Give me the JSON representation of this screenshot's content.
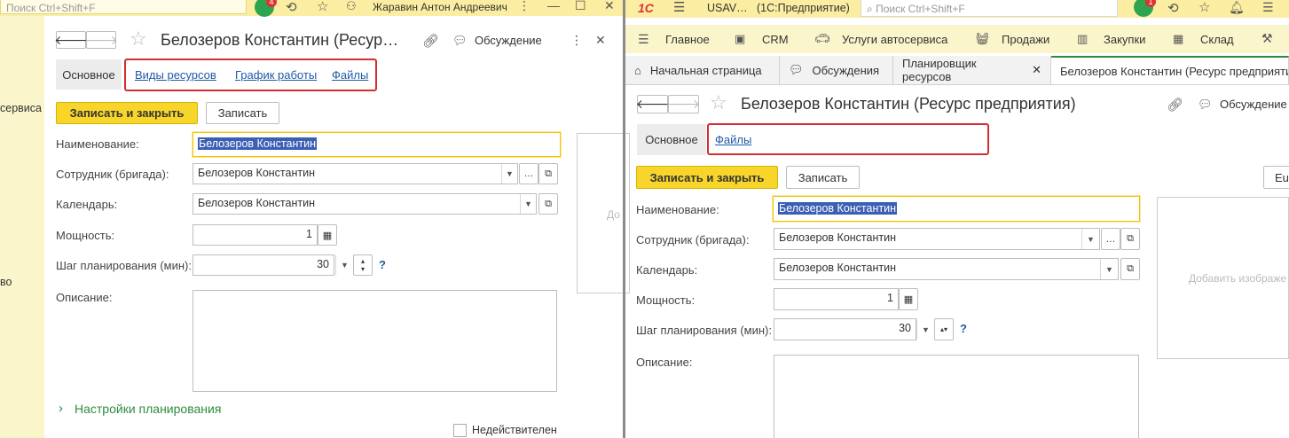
{
  "left": {
    "search_placeholder": "Поиск Ctrl+Shift+F",
    "badge_count": "4",
    "user_name": "Жаравин Антон Андреевич",
    "sidebar_text_1": "сервиса",
    "sidebar_text_2": "во",
    "form_title": "Белозеров Константин (Ресур…",
    "discussion_label": "Обсуждение",
    "tabs": {
      "main": "Основное",
      "resource_types": "Виды ресурсов",
      "schedule": "График работы",
      "files": "Файлы"
    },
    "btn_save_close": "Записать и закрыть",
    "btn_save": "Записать",
    "labels": {
      "name": "Наименование:",
      "employee": "Сотрудник (бригада):",
      "calendar": "Календарь:",
      "power": "Мощность:",
      "step": "Шаг планирования (мин):",
      "description": "Описание:"
    },
    "values": {
      "name": "Белозеров Константин",
      "employee": "Белозеров Константин",
      "calendar": "Белозеров Константин",
      "power": "1",
      "step": "30"
    },
    "image_placeholder_partial": "До",
    "planning_settings": "Настройки планирования",
    "inactive_label": "Недействителен"
  },
  "right": {
    "app_name": "1С",
    "app_title": "USAV…",
    "app_mode": "(1С:Предприятие)",
    "search_placeholder": "Поиск Ctrl+Shift+F",
    "badge_count": "1",
    "menu": [
      "Главное",
      "CRM",
      "Услуги автосервиса",
      "Продажи",
      "Закупки",
      "Склад"
    ],
    "open_tabs": [
      "Начальная страница",
      "Обсуждения",
      "Планировщик ресурсов",
      "Белозеров Константин (Ресурс предприяти"
    ],
    "form_title": "Белозеров Константин (Ресурс предприятия)",
    "discussion_label": "Обсуждение",
    "tabs": {
      "main": "Основное",
      "files": "Файлы"
    },
    "btn_save_close": "Записать и закрыть",
    "btn_save": "Записать",
    "btn_partial": "Eu",
    "labels": {
      "name": "Наименование:",
      "employee": "Сотрудник (бригада):",
      "calendar": "Календарь:",
      "power": "Мощность:",
      "step": "Шаг планирования (мин):",
      "description": "Описание:"
    },
    "values": {
      "name": "Белозеров Константин",
      "employee": "Белозеров Константин",
      "calendar": "Белозеров Константин",
      "power": "1",
      "step": "30"
    },
    "image_placeholder": "Добавить изображе"
  },
  "colors": {
    "accent_yellow": "#f8d52a",
    "topbar": "#fbeea2",
    "highlight_red": "#d03030",
    "link": "#1f5aa6"
  }
}
